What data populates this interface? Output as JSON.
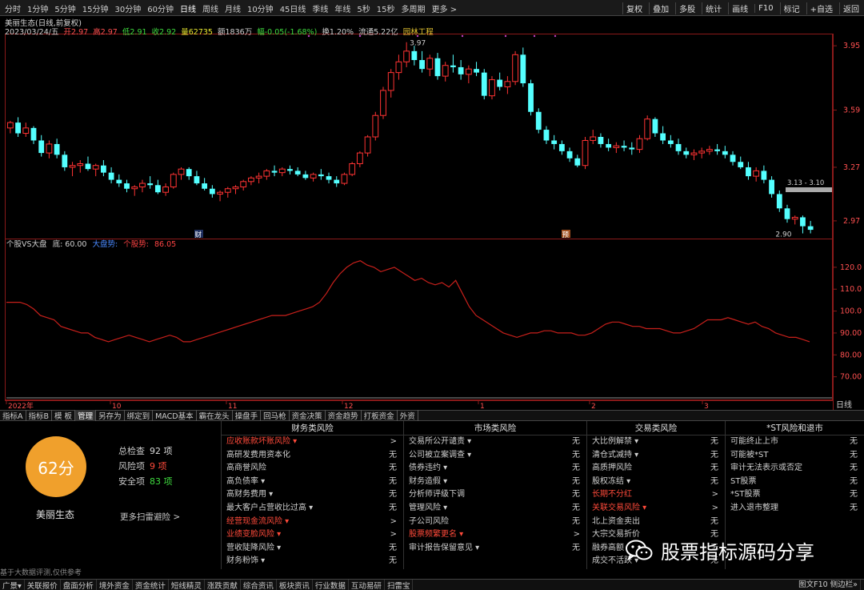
{
  "toolbar": {
    "periods": [
      "分时",
      "1分钟",
      "5分钟",
      "15分钟",
      "30分钟",
      "60分钟",
      "日线",
      "周线",
      "月线",
      "10分钟",
      "45日线",
      "季线",
      "年线",
      "5秒",
      "15秒",
      "多周期",
      "更多 >"
    ],
    "active": "日线",
    "tools": [
      "复权",
      "叠加",
      "多股",
      "统计",
      "画线",
      "F10",
      "标记",
      "+自选",
      "返回"
    ]
  },
  "header": {
    "line1": "美丽生态(日线,前复权)",
    "date": "2023/03/24/五",
    "open": "开2.97",
    "high": "高2.97",
    "low": "低2.91",
    "close": "收2.92",
    "volume": "量62735",
    "amount": "额1836万",
    "change": "幅-0.05(-1.68%)",
    "turnover": "换1.20%",
    "float": "流通5.22亿",
    "industry": "园林工程"
  },
  "colors": {
    "up": "#ff3333",
    "down": "#54ffff",
    "line": "#c8201b",
    "industry": "#e8c832",
    "grid": "#8b1a1a"
  },
  "price_axis": [
    "3.95",
    "3.59",
    "3.27",
    "2.97"
  ],
  "price_annotations": {
    "high": "3.97",
    "low": "2.90",
    "range": "3.13 - 3.10"
  },
  "markers": [
    "财",
    "预"
  ],
  "indicator": {
    "title": "个股VS大盘",
    "base": "底: 60.00",
    "market_label": "大盘势:",
    "stock_label": "个股势:",
    "stock_value": "86.05",
    "axis": [
      "120.0",
      "110.0",
      "100.0",
      "90.00",
      "80.00",
      "70.00"
    ]
  },
  "date_axis": [
    "2022年",
    "10",
    "11",
    "12",
    "1",
    "2",
    "3"
  ],
  "date_period": "日线",
  "chart_data": {
    "type": "candlestick+line",
    "candles": [
      [
        3.49,
        3.53,
        3.46,
        3.52
      ],
      [
        3.52,
        3.55,
        3.44,
        3.46
      ],
      [
        3.46,
        3.52,
        3.44,
        3.49
      ],
      [
        3.49,
        3.5,
        3.4,
        3.42
      ],
      [
        3.42,
        3.45,
        3.33,
        3.35
      ],
      [
        3.35,
        3.42,
        3.32,
        3.4
      ],
      [
        3.4,
        3.43,
        3.32,
        3.34
      ],
      [
        3.34,
        3.36,
        3.25,
        3.27
      ],
      [
        3.27,
        3.3,
        3.22,
        3.28
      ],
      [
        3.28,
        3.31,
        3.24,
        3.29
      ],
      [
        3.29,
        3.33,
        3.25,
        3.26
      ],
      [
        3.26,
        3.29,
        3.22,
        3.28
      ],
      [
        3.28,
        3.31,
        3.22,
        3.24
      ],
      [
        3.24,
        3.27,
        3.18,
        3.2
      ],
      [
        3.2,
        3.23,
        3.16,
        3.18
      ],
      [
        3.18,
        3.2,
        3.13,
        3.15
      ],
      [
        3.15,
        3.17,
        3.11,
        3.16
      ],
      [
        3.16,
        3.2,
        3.13,
        3.18
      ],
      [
        3.18,
        3.22,
        3.15,
        3.17
      ],
      [
        3.17,
        3.2,
        3.12,
        3.13
      ],
      [
        3.13,
        3.18,
        3.11,
        3.16
      ],
      [
        3.16,
        3.24,
        3.15,
        3.23
      ],
      [
        3.23,
        3.27,
        3.2,
        3.26
      ],
      [
        3.26,
        3.27,
        3.2,
        3.22
      ],
      [
        3.22,
        3.25,
        3.17,
        3.18
      ],
      [
        3.18,
        3.21,
        3.14,
        3.15
      ],
      [
        3.15,
        3.17,
        3.1,
        3.12
      ],
      [
        3.12,
        3.14,
        3.08,
        3.13
      ],
      [
        3.13,
        3.16,
        3.1,
        3.15
      ],
      [
        3.15,
        3.17,
        3.12,
        3.16
      ],
      [
        3.16,
        3.2,
        3.14,
        3.19
      ],
      [
        3.19,
        3.22,
        3.17,
        3.21
      ],
      [
        3.21,
        3.24,
        3.18,
        3.22
      ],
      [
        3.22,
        3.26,
        3.2,
        3.25
      ],
      [
        3.25,
        3.28,
        3.22,
        3.24
      ],
      [
        3.24,
        3.27,
        3.22,
        3.26
      ],
      [
        3.26,
        3.28,
        3.23,
        3.25
      ],
      [
        3.25,
        3.27,
        3.22,
        3.23
      ],
      [
        3.23,
        3.25,
        3.2,
        3.21
      ],
      [
        3.21,
        3.24,
        3.19,
        3.23
      ],
      [
        3.23,
        3.26,
        3.2,
        3.22
      ],
      [
        3.22,
        3.24,
        3.18,
        3.2
      ],
      [
        3.2,
        3.22,
        3.16,
        3.18
      ],
      [
        3.18,
        3.24,
        3.17,
        3.23
      ],
      [
        3.23,
        3.3,
        3.22,
        3.29
      ],
      [
        3.29,
        3.36,
        3.27,
        3.35
      ],
      [
        3.35,
        3.45,
        3.33,
        3.44
      ],
      [
        3.44,
        3.58,
        3.42,
        3.56
      ],
      [
        3.56,
        3.72,
        3.54,
        3.7
      ],
      [
        3.7,
        3.82,
        3.66,
        3.8
      ],
      [
        3.8,
        3.9,
        3.76,
        3.86
      ],
      [
        3.86,
        3.97,
        3.83,
        3.92
      ],
      [
        3.92,
        3.95,
        3.84,
        3.87
      ],
      [
        3.87,
        3.92,
        3.8,
        3.82
      ],
      [
        3.82,
        3.9,
        3.78,
        3.88
      ],
      [
        3.88,
        3.91,
        3.76,
        3.78
      ],
      [
        3.78,
        3.86,
        3.75,
        3.84
      ],
      [
        3.84,
        3.9,
        3.8,
        3.83
      ],
      [
        3.83,
        3.87,
        3.76,
        3.79
      ],
      [
        3.79,
        3.84,
        3.74,
        3.82
      ],
      [
        3.82,
        3.86,
        3.78,
        3.8
      ],
      [
        3.8,
        3.82,
        3.65,
        3.67
      ],
      [
        3.67,
        3.78,
        3.65,
        3.76
      ],
      [
        3.76,
        3.8,
        3.7,
        3.72
      ],
      [
        3.72,
        3.78,
        3.68,
        3.75
      ],
      [
        3.75,
        3.92,
        3.73,
        3.9
      ],
      [
        3.9,
        3.94,
        3.72,
        3.74
      ],
      [
        3.74,
        3.76,
        3.56,
        3.58
      ],
      [
        3.58,
        3.6,
        3.46,
        3.48
      ],
      [
        3.48,
        3.5,
        3.4,
        3.42
      ],
      [
        3.42,
        3.45,
        3.37,
        3.4
      ],
      [
        3.4,
        3.42,
        3.34,
        3.36
      ],
      [
        3.36,
        3.38,
        3.3,
        3.32
      ],
      [
        3.32,
        3.34,
        3.27,
        3.28
      ],
      [
        3.28,
        3.44,
        3.26,
        3.42
      ],
      [
        3.42,
        3.48,
        3.4,
        3.44
      ],
      [
        3.44,
        3.46,
        3.38,
        3.4
      ],
      [
        3.4,
        3.43,
        3.36,
        3.38
      ],
      [
        3.38,
        3.41,
        3.35,
        3.39
      ],
      [
        3.39,
        3.42,
        3.36,
        3.38
      ],
      [
        3.38,
        3.41,
        3.34,
        3.37
      ],
      [
        3.37,
        3.45,
        3.35,
        3.43
      ],
      [
        3.43,
        3.56,
        3.42,
        3.54
      ],
      [
        3.54,
        3.55,
        3.44,
        3.46
      ],
      [
        3.46,
        3.5,
        3.4,
        3.42
      ],
      [
        3.42,
        3.45,
        3.38,
        3.4
      ],
      [
        3.4,
        3.43,
        3.34,
        3.36
      ],
      [
        3.36,
        3.38,
        3.32,
        3.34
      ],
      [
        3.34,
        3.37,
        3.31,
        3.35
      ],
      [
        3.35,
        3.38,
        3.32,
        3.36
      ],
      [
        3.36,
        3.39,
        3.34,
        3.37
      ],
      [
        3.37,
        3.4,
        3.34,
        3.36
      ],
      [
        3.36,
        3.39,
        3.32,
        3.34
      ],
      [
        3.34,
        3.36,
        3.28,
        3.3
      ],
      [
        3.3,
        3.33,
        3.26,
        3.27
      ],
      [
        3.27,
        3.3,
        3.2,
        3.22
      ],
      [
        3.22,
        3.27,
        3.19,
        3.25
      ],
      [
        3.25,
        3.28,
        3.18,
        3.2
      ],
      [
        3.2,
        3.22,
        3.1,
        3.12
      ],
      [
        3.12,
        3.14,
        3.02,
        3.04
      ],
      [
        3.04,
        3.06,
        2.96,
        2.98
      ],
      [
        2.98,
        3.0,
        2.95,
        2.99
      ],
      [
        2.99,
        3.0,
        2.9,
        2.94
      ],
      [
        2.94,
        2.97,
        2.9,
        2.92
      ]
    ],
    "strength": [
      104,
      104,
      104,
      103,
      101,
      98,
      97,
      96,
      93,
      92,
      91,
      90,
      90,
      88,
      87,
      86,
      87,
      88,
      89,
      88,
      87,
      86,
      87,
      88,
      89,
      88,
      86,
      86,
      87,
      88,
      89,
      90,
      91,
      92,
      93,
      94,
      95,
      96,
      97,
      98,
      98,
      98,
      99,
      100,
      101,
      102,
      104,
      108,
      113,
      117,
      120,
      122,
      123,
      121,
      120,
      118,
      119,
      120,
      118,
      116,
      114,
      115,
      113,
      112,
      113,
      111,
      114,
      108,
      102,
      98,
      96,
      94,
      92,
      90,
      89,
      88,
      89,
      90,
      90,
      91,
      91,
      90,
      90,
      90,
      89,
      89,
      90,
      92,
      94,
      95,
      95,
      94,
      93,
      93,
      92,
      92,
      92,
      91,
      90,
      90,
      91,
      92,
      94,
      96,
      96,
      96,
      97,
      96,
      95,
      94,
      95,
      93,
      92,
      90,
      89,
      88,
      88,
      87,
      86
    ],
    "y_price_range": [
      2.88,
      4.0
    ],
    "y_strength_range": [
      60,
      128
    ]
  },
  "panel": {
    "score": "62分",
    "stock_name": "美丽生态",
    "total_label": "总检查",
    "total_value": "92 项",
    "risk_label": "风险项",
    "risk_value": "9 项",
    "safe_label": "安全项",
    "safe_value": "83 项",
    "more": "更多扫雷避险 >",
    "disclaimer": "基于大数据评测,仅供参考",
    "columns": [
      {
        "header": "财务类风险",
        "rows": [
          {
            "label": "应收账款坏账风险 ▾",
            "value": ">",
            "red": true
          },
          {
            "label": "高研发费用资本化",
            "value": "无"
          },
          {
            "label": "高商誉风险",
            "value": "无"
          },
          {
            "label": "高负债率 ▾",
            "value": "无"
          },
          {
            "label": "高财务费用 ▾",
            "value": "无"
          },
          {
            "label": "最大客户占营收比过高 ▾",
            "value": "无"
          },
          {
            "label": "经营现金流风险 ▾",
            "value": ">",
            "red": true
          },
          {
            "label": "业绩变脸风险 ▾",
            "value": ">",
            "red": true
          },
          {
            "label": "营收陡降风险 ▾",
            "value": "无"
          },
          {
            "label": "财务粉饰 ▾",
            "value": "无"
          }
        ]
      },
      {
        "header": "市场类风险",
        "rows": [
          {
            "label": "交易所公开谴责 ▾",
            "value": "无"
          },
          {
            "label": "公司被立案调查 ▾",
            "value": "无"
          },
          {
            "label": "债券违约 ▾",
            "value": "无"
          },
          {
            "label": "财务造假 ▾",
            "value": "无"
          },
          {
            "label": "分析师评级下调",
            "value": "无"
          },
          {
            "label": "管理风险 ▾",
            "value": "无"
          },
          {
            "label": "子公司风险",
            "value": "无"
          },
          {
            "label": "股票频繁更名 ▾",
            "value": ">",
            "red": true
          },
          {
            "label": "审计报告保留意见 ▾",
            "value": "无"
          }
        ]
      },
      {
        "header": "交易类风险",
        "rows": [
          {
            "label": "大比例解禁 ▾",
            "value": "无"
          },
          {
            "label": "清仓式减持 ▾",
            "value": "无"
          },
          {
            "label": "高质押风险",
            "value": "无"
          },
          {
            "label": "股权冻结 ▾",
            "value": "无"
          },
          {
            "label": "长期不分红",
            "value": ">",
            "red": true
          },
          {
            "label": "关联交易风险 ▾",
            "value": ">",
            "red": true
          },
          {
            "label": "北上资金卖出",
            "value": "无"
          },
          {
            "label": "大宗交易折价",
            "value": "无"
          },
          {
            "label": "融券高额",
            "value": "无"
          },
          {
            "label": "成交不活跃 ▾",
            "value": "无"
          }
        ]
      },
      {
        "header": "*ST风险和退市",
        "rows": [
          {
            "label": "可能终止上市",
            "value": "无"
          },
          {
            "label": "可能被*ST",
            "value": "无"
          },
          {
            "label": "审计无法表示或否定",
            "value": "无"
          },
          {
            "label": "ST股票",
            "value": "无"
          },
          {
            "label": "*ST股票",
            "value": "无"
          },
          {
            "label": "进入退市整理",
            "value": "无"
          }
        ]
      }
    ]
  },
  "tabs": [
    "指标A",
    "指标B",
    "模 板",
    "管理",
    "另存为",
    "绑定到",
    "MACD基本",
    "霸在龙头",
    "操盘手",
    "回马枪",
    "资金决策",
    "资金趋势",
    "打板资金",
    "外资"
  ],
  "tab_active": "管理",
  "status": {
    "items": [
      "广景▾",
      "关联报价",
      "盘面分析",
      "境外资金",
      "资金统计",
      "短线精灵",
      "涨跌贡献",
      "综合资讯",
      "板块资讯",
      "行业数据",
      "互动易研",
      "扫雷宝"
    ],
    "right": "图文F10 侧边栏»"
  },
  "watermark": "股票指标源码分享"
}
